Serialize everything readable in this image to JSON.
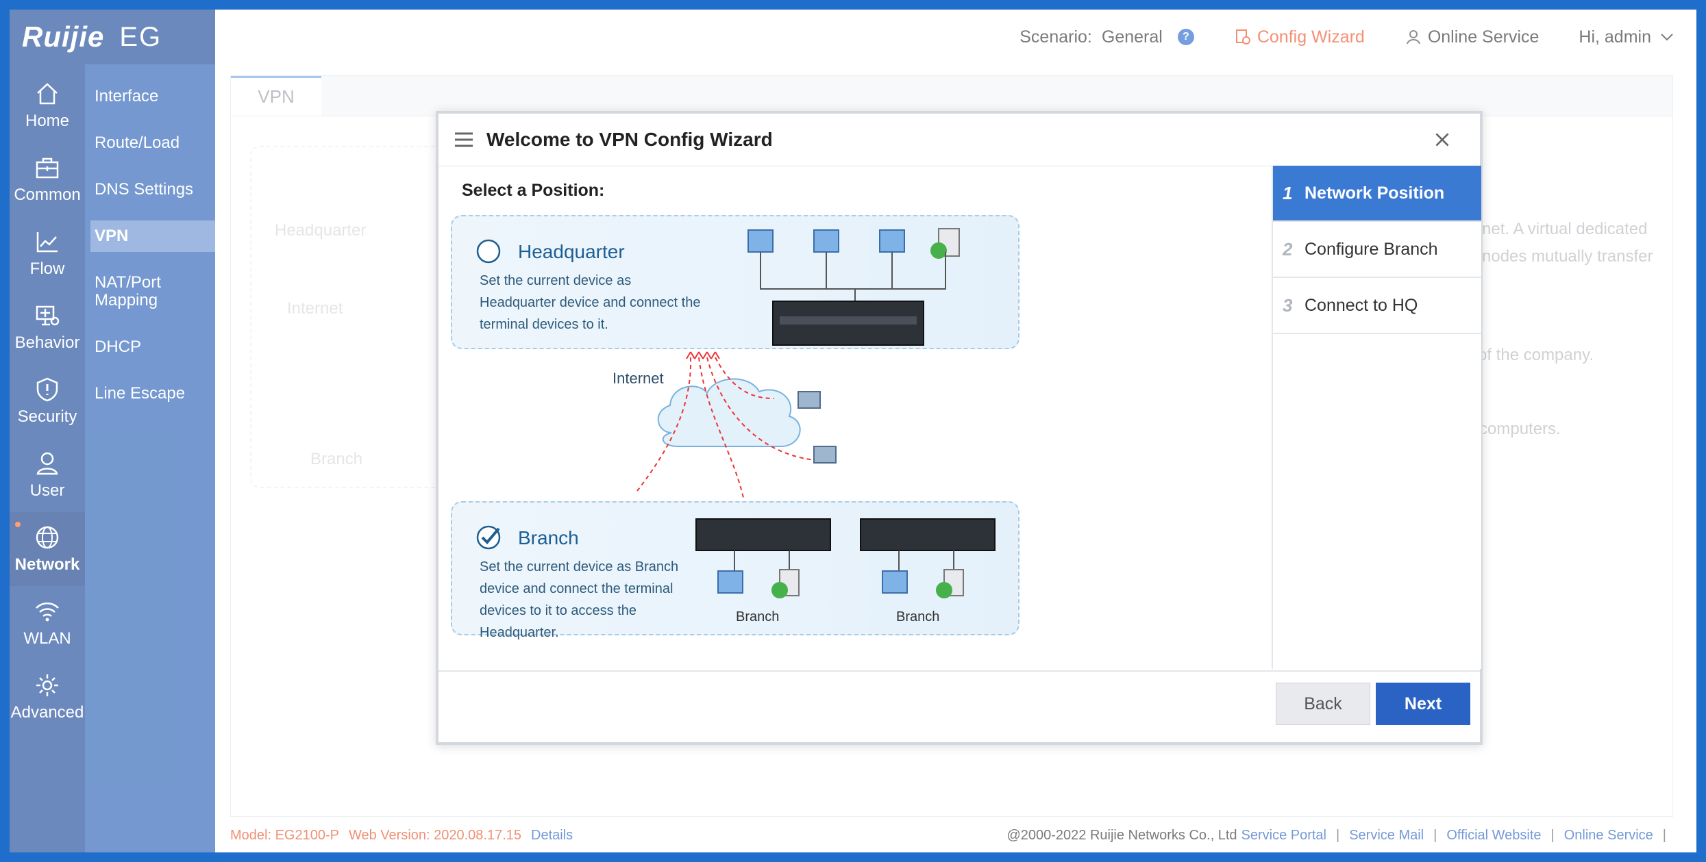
{
  "brand": {
    "logo": "Ruijie",
    "model": "EG"
  },
  "topbar": {
    "scenario_label": "Scenario:",
    "scenario_value": "General",
    "help_icon": "question-icon",
    "config_wizard": "Config Wizard",
    "online_service": "Online Service",
    "user": "Hi, admin"
  },
  "rail": [
    {
      "label": "Home",
      "icon": "home-icon"
    },
    {
      "label": "Common",
      "icon": "toolbox-icon"
    },
    {
      "label": "Flow",
      "icon": "chart-icon"
    },
    {
      "label": "Behavior",
      "icon": "monitor-icon"
    },
    {
      "label": "Security",
      "icon": "shield-icon"
    },
    {
      "label": "User",
      "icon": "user-icon"
    },
    {
      "label": "Network",
      "icon": "globe-icon",
      "active": true
    },
    {
      "label": "WLAN",
      "icon": "wifi-icon"
    },
    {
      "label": "Advanced",
      "icon": "gear-icon"
    }
  ],
  "submenu": [
    "Interface",
    "Route/Load",
    "DNS Settings",
    "VPN",
    "NAT/Port Mapping",
    "DHCP",
    "Line Escape"
  ],
  "main": {
    "tab": "VPN",
    "bg_headquarter": "Headquarter",
    "bg_internet": "Internet",
    "bg_branch": "Branch",
    "bg_text_1": "rnet. A virtual dedicated",
    "bg_text_2": "nodes mutually transfer",
    "bg_text_3": "of the company.",
    "bg_text_4": "computers."
  },
  "dialog": {
    "title": "Welcome to VPN Config Wizard",
    "select_title": "Select a Position:",
    "hq_title": "Headquarter",
    "hq_desc": "Set the current device as Headquarter device and connect the terminal devices to it.",
    "internet": "Internet",
    "branch_title": "Branch",
    "branch_desc": "Set the current device as Branch device and connect the terminal devices to it to access the Headquarter.",
    "branch_cap_1": "Branch",
    "branch_cap_2": "Branch",
    "steps": [
      {
        "num": "1",
        "label": "Network Position"
      },
      {
        "num": "2",
        "label": "Configure Branch"
      },
      {
        "num": "3",
        "label": "Connect to HQ"
      }
    ],
    "back": "Back",
    "next": "Next"
  },
  "footer": {
    "model": "Model:  EG2100-P",
    "web_version": "Web Version:  2020.08.17.15",
    "details": "Details",
    "copyright": "@2000-2022 Ruijie Networks Co., Ltd",
    "links": [
      "Service Portal",
      "Service Mail",
      "Official Website",
      "Online Service"
    ]
  },
  "colors": {
    "rail": "#1d4b99",
    "submenu": "#2a62b6",
    "accent": "#2a63c4",
    "wizard": "#f0542a"
  }
}
